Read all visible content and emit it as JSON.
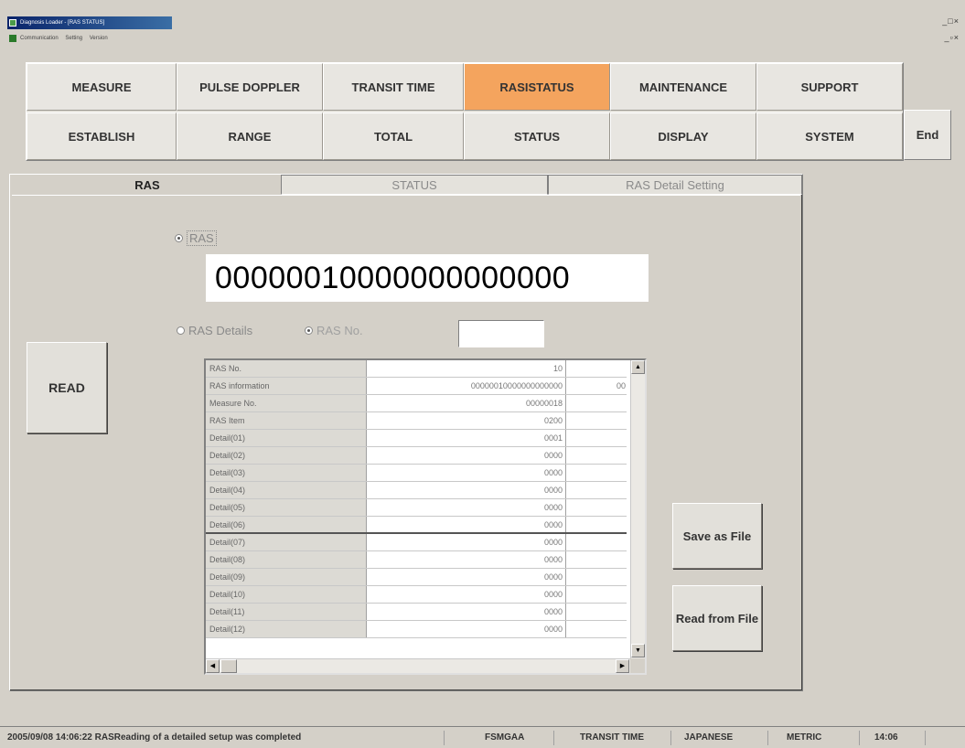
{
  "window": {
    "title": "Diagnosis Loader - [RAS STATUS]",
    "menu": [
      "Communication",
      "Setting",
      "Version"
    ],
    "controls": "_□×",
    "mdi_controls": "_▫×"
  },
  "nav": {
    "row1": [
      "MEASURE",
      "PULSE DOPPLER",
      "TRANSIT TIME",
      "RASISTATUS",
      "MAINTENANCE",
      "SUPPORT"
    ],
    "row2": [
      "ESTABLISH",
      "RANGE",
      "TOTAL",
      "STATUS",
      "DISPLAY",
      "SYSTEM"
    ],
    "active": "RASISTATUS",
    "end_label": "End"
  },
  "tabs": [
    "RAS",
    "STATUS",
    "RAS Detail Setting"
  ],
  "ras_panel": {
    "radio_ras_label": "RAS",
    "ras_value": "00000010000000000000",
    "ras_details_label": "RAS Details",
    "ras_no_label": "RAS No.",
    "ras_no_value": ""
  },
  "buttons": {
    "read": "READ",
    "save_as_file": "Save as File",
    "read_from_file": "Read from File"
  },
  "table": {
    "rows": [
      [
        "RAS No.",
        "10",
        ""
      ],
      [
        "RAS information",
        "00000010000000000000",
        "00"
      ],
      [
        "Measure No.",
        "00000018",
        ""
      ],
      [
        "RAS Item",
        "0200",
        ""
      ],
      [
        "Detail(01)",
        "0001",
        ""
      ],
      [
        "Detail(02)",
        "0000",
        ""
      ],
      [
        "Detail(03)",
        "0000",
        ""
      ],
      [
        "Detail(04)",
        "0000",
        ""
      ],
      [
        "Detail(05)",
        "0000",
        ""
      ],
      [
        "Detail(06)",
        "0000",
        ""
      ],
      [
        "Detail(07)",
        "0000",
        ""
      ],
      [
        "Detail(08)",
        "0000",
        ""
      ],
      [
        "Detail(09)",
        "0000",
        ""
      ],
      [
        "Detail(10)",
        "0000",
        ""
      ],
      [
        "Detail(11)",
        "0000",
        ""
      ],
      [
        "Detail(12)",
        "0000",
        ""
      ]
    ]
  },
  "statusbar": {
    "message": "2005/09/08 14:06:22 RASReading of a detailed setup was completed",
    "device": "FSMGAA",
    "mode": "TRANSIT TIME",
    "language": "JAPANESE",
    "units": "METRIC",
    "time": "14:06"
  },
  "colors": {
    "active_nav": "#f4a45e",
    "face": "#d4d0c8",
    "titlebar": "#0a246a"
  }
}
